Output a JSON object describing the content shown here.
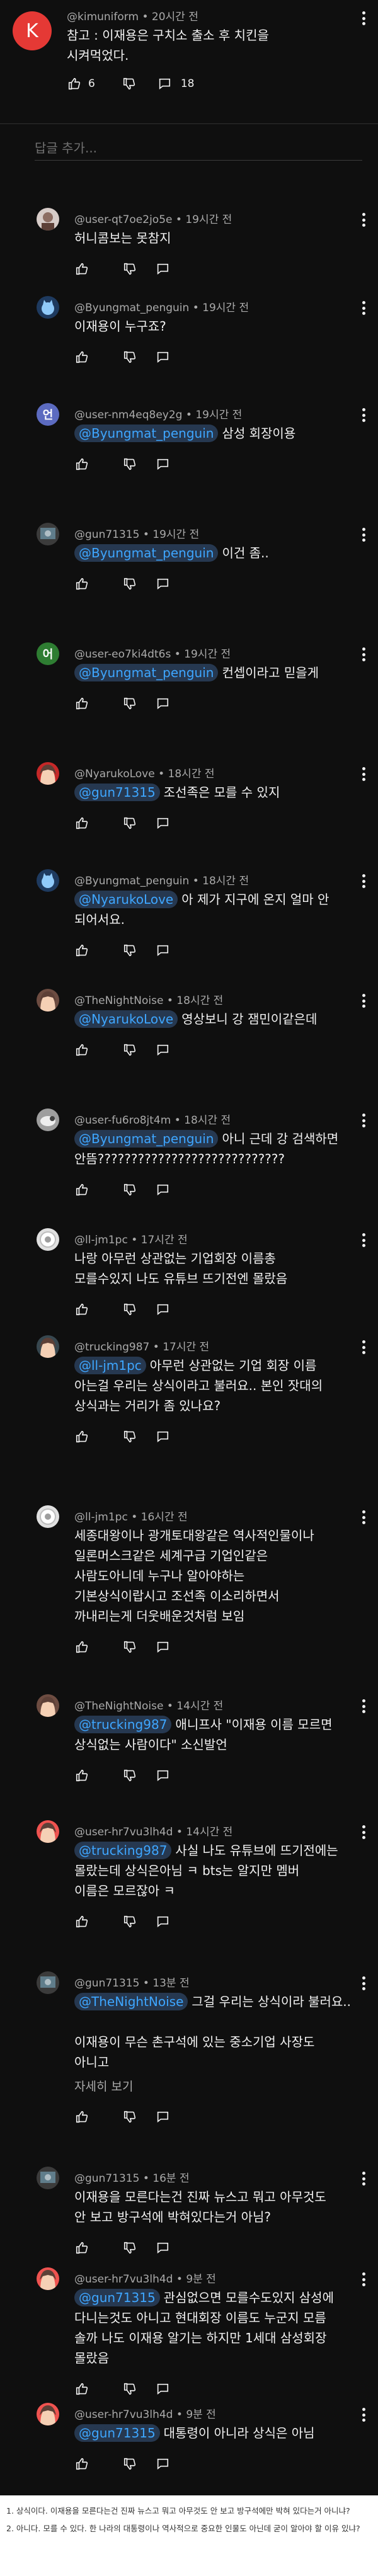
{
  "top_comment": {
    "avatar_letter": "K",
    "author": "@kimuniform",
    "time": "20시간 전",
    "lines": [
      "참고 : 이재용은 구치소 출소 후 치킨을",
      "시켜먹었다."
    ],
    "likes": "6",
    "replies": "18"
  },
  "reply_placeholder": "답글 추가...",
  "replies": [
    {
      "author": "@user-qt7oe2jo5e",
      "time": "19시간 전",
      "lines": [
        "허니콤보는 못참지"
      ],
      "likes": ""
    },
    {
      "author": "@Byungmat_penguin",
      "time": "19시간 전",
      "lines": [
        "이재용이 누구죠?"
      ],
      "likes": ""
    },
    {
      "author": "@user-nm4eq8ey2g",
      "time": "19시간 전",
      "avatar_letter": "언",
      "mention": "@Byungmat_penguin",
      "lines": [
        "삼성 회장이용"
      ],
      "likes": ""
    },
    {
      "author": "@gun71315",
      "time": "19시간 전",
      "mention": "@Byungmat_penguin",
      "lines": [
        "이건 좀.."
      ],
      "likes": ""
    },
    {
      "author": "@user-eo7ki4dt6s",
      "time": "19시간 전",
      "avatar_letter": "어",
      "mention": "@Byungmat_penguin",
      "lines": [
        "컨셉이라고 믿을게"
      ],
      "likes": ""
    },
    {
      "author": "@NyarukoLove",
      "time": "18시간 전",
      "mention": "@gun71315",
      "lines": [
        "조선족은 모를 수 있지"
      ],
      "likes": ""
    },
    {
      "author": "@Byungmat_penguin",
      "time": "18시간 전",
      "mention": "@NyarukoLove",
      "lines": [
        "아 제가 지구에 온지 얼마 안",
        "되어서요."
      ],
      "likes": ""
    },
    {
      "author": "@TheNightNoise",
      "time": "18시간 전",
      "mention": "@NyarukoLove",
      "lines": [
        "영상보니 강 잼민이같은데"
      ],
      "likes": ""
    },
    {
      "author": "@user-fu6ro8jt4m",
      "time": "18시간 전",
      "mention": "@Byungmat_penguin",
      "lines": [
        "아니 근데 강 검색하면",
        "안뜸????????????????????????????"
      ],
      "likes": ""
    },
    {
      "author": "@ll-jm1pc",
      "time": "17시간 전",
      "lines": [
        "나랑 아무런 상관없는 기업회장 이름총",
        "모를수있지 나도 유튜브 뜨기전엔 몰랐음"
      ],
      "likes": ""
    },
    {
      "author": "@trucking987",
      "time": "17시간 전",
      "mention": "@ll-jm1pc",
      "lines": [
        "아무런 상관없는 기업 회장 이름",
        "아는걸 우리는 상식이라고 불러요.. 본인 잣대의",
        "상식과는 거리가 좀 있나요?"
      ],
      "likes": ""
    },
    {
      "author": "@ll-jm1pc",
      "time": "16시간 전",
      "lines": [
        "세종대왕이나 광개토대왕같은 역사적인물이나",
        "일론머스크같은 세계구급 기업인같은",
        "사람도아니데 누구나 알아야하는",
        "기본상식이랍시고 조선족 이소리하면서",
        "까내리는게 더웃배운것처럼 보임"
      ],
      "likes": ""
    },
    {
      "author": "@TheNightNoise",
      "time": "14시간 전",
      "mention": "@trucking987",
      "lines": [
        "애니프사 \"이재용 이름 모르면",
        "상식없는 사람이다\" 소신발언"
      ],
      "likes": ""
    },
    {
      "author": "@user-hr7vu3lh4d",
      "time": "14시간 전",
      "mention": "@trucking987",
      "lines": [
        "사실 나도 유튜브에 뜨기전에는",
        "몰랐는데 상식은아님 ㅋ bts는 알지만 멤버",
        "이름은 모르잖아 ㅋ"
      ],
      "likes": ""
    },
    {
      "author": "@gun71315",
      "time": "13분 전",
      "mention": "@TheNightNoise",
      "lines": [
        "그걸 우리는 상식이라 불러요..",
        "",
        "이재용이 무슨 촌구석에 있는 중소기업 사장도",
        "아니고"
      ],
      "see_more": "자세히 보기",
      "likes": ""
    },
    {
      "author": "@gun71315",
      "time": "16분 전",
      "lines": [
        "이재용을 모른다는건 진짜 뉴스고 뭐고 아무것도",
        "안 보고 방구석에 박혀있다는거 아님?"
      ],
      "likes": ""
    },
    {
      "author": "@user-hr7vu3lh4d",
      "time": "9분 전",
      "mention": "@gun71315",
      "lines": [
        "관심없으면 모를수도있지 삼성에",
        "다니는것도 아니고 현대회장 이름도 누군지 모름",
        "솔까 나도 이재용 알기는 하지만 1세대 삼성회장",
        "몰랐음"
      ],
      "likes": ""
    },
    {
      "author": "@user-hr7vu3lh4d",
      "time": "9분 전",
      "mention": "@gun71315",
      "lines": [
        "대통령이 아니라 상식은 아님"
      ],
      "likes": ""
    }
  ],
  "footer": {
    "note1": "1. 상식이다. 이재용을 모른다는건 진짜 뉴스고 뭐고 아무것도 안 보고 방구석에만 박혀 있다는거 아니냐?",
    "note2": "2. 아니다. 모를 수 있다. 한 나라의 대통령이나 역사적으로 중요한 인물도 아닌데 굳이 알아야 할 이유 있냐?"
  }
}
